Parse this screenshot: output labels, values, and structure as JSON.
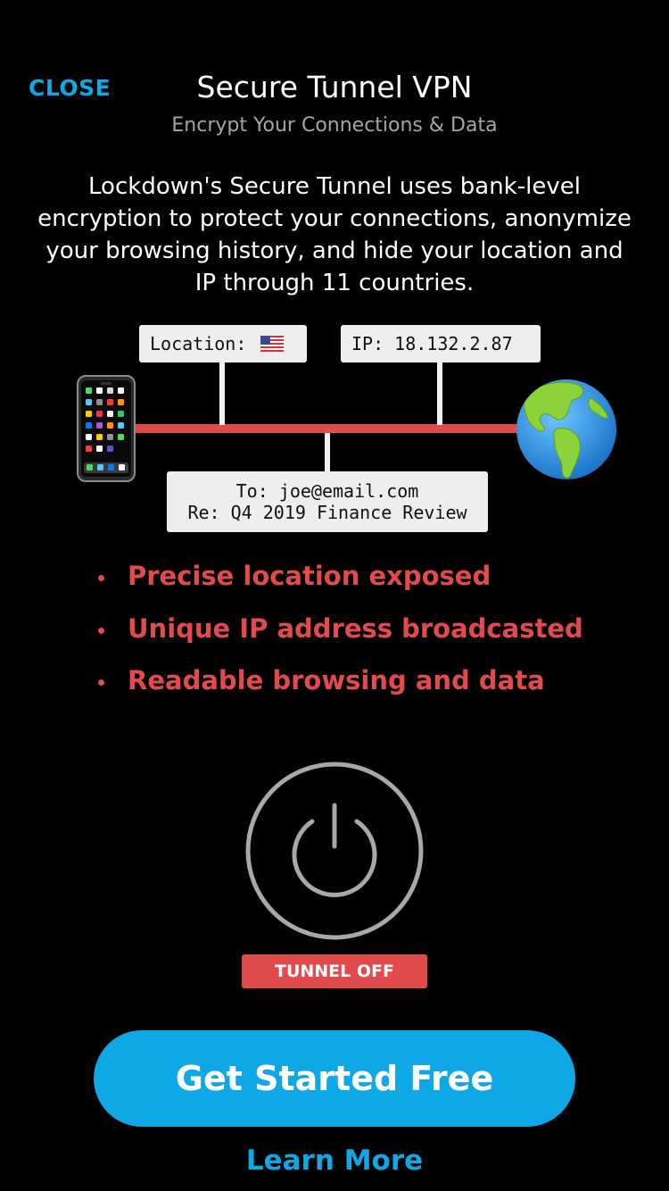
{
  "header": {
    "close_label": "CLOSE",
    "title": "Secure Tunnel VPN",
    "subtitle": "Encrypt Your Connections & Data"
  },
  "description": "Lockdown's Secure Tunnel uses bank-level encryption to protect your connections, anonymize your browsing history, and hide your location and IP through 11 countries.",
  "diagram": {
    "location_label": "Location:",
    "location_flag": "us-flag",
    "ip_label": "IP: 18.132.2.87",
    "mail_to": "To: joe@email.com",
    "mail_subject": "Re: Q4 2019 Finance Review",
    "left_icon": "smartphone-icon",
    "right_icon": "globe-icon",
    "tunnel_color": "#e24b4b"
  },
  "risks": [
    "Precise location exposed",
    "Unique IP address broadcasted",
    "Readable browsing and data"
  ],
  "power": {
    "icon": "power-icon",
    "status_label": "TUNNEL OFF",
    "status_color": "#e24b4b"
  },
  "cta": {
    "primary_label": "Get Started Free",
    "secondary_label": "Learn More",
    "accent_color": "#0ea8e6"
  }
}
